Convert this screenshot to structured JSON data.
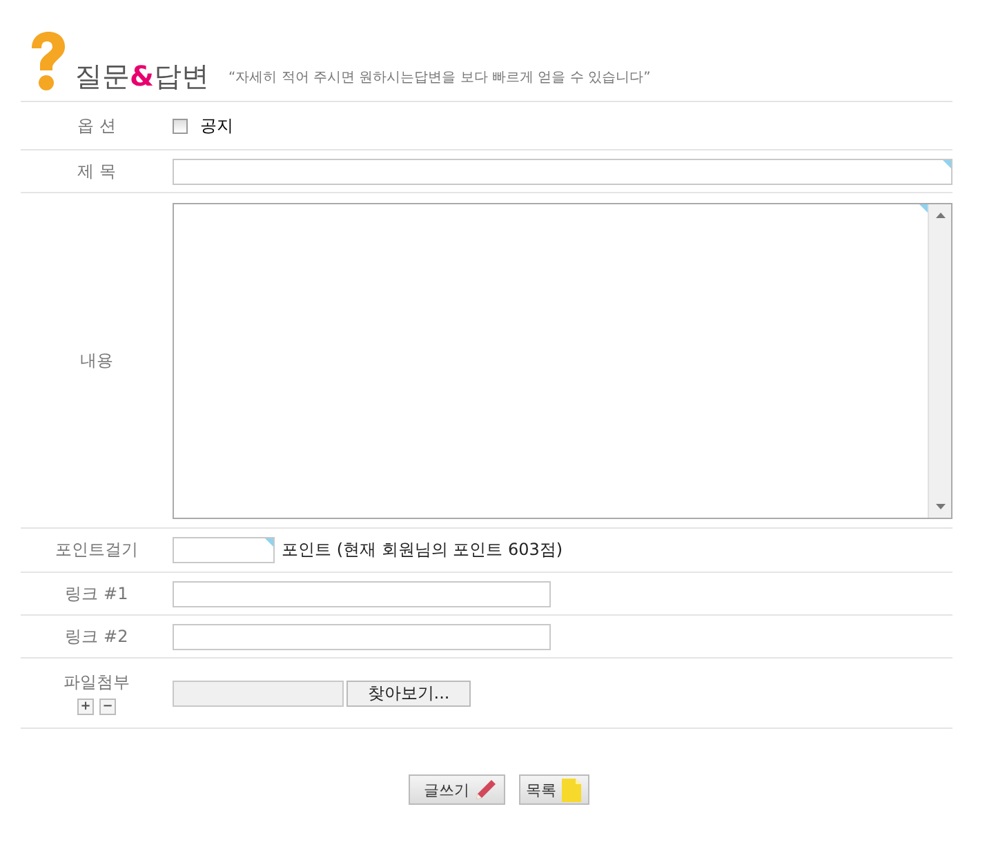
{
  "header": {
    "title": [
      {
        "text": "질문",
        "highlight": false
      },
      {
        "text": "&",
        "highlight": true
      },
      {
        "text": "답변",
        "highlight": false
      }
    ],
    "subtitle": "“자세히 적어 주시면 원하시는답변을 보다 빠르게 얻을 수 있습니다”"
  },
  "form": {
    "rows": [
      {
        "kind": "checkbox",
        "label": "옵 션",
        "option": "공지",
        "checked": false
      },
      {
        "kind": "wide_text",
        "label": "제 목"
      },
      {
        "kind": "textarea",
        "label": "내용"
      },
      {
        "kind": "points",
        "label": "포인트걸기",
        "note": "포인트 (현재 회원님의 포인트 603점)"
      },
      {
        "kind": "text",
        "label": "링크 #1"
      },
      {
        "kind": "text",
        "label": "링크 #2"
      },
      {
        "kind": "file",
        "label": "파일첨부",
        "browse": "찾아보기...",
        "add": "+",
        "remove": "−"
      }
    ]
  },
  "buttons": [
    {
      "kind": "write",
      "label": "글쓰기"
    },
    {
      "kind": "list",
      "label": "목록"
    }
  ]
}
